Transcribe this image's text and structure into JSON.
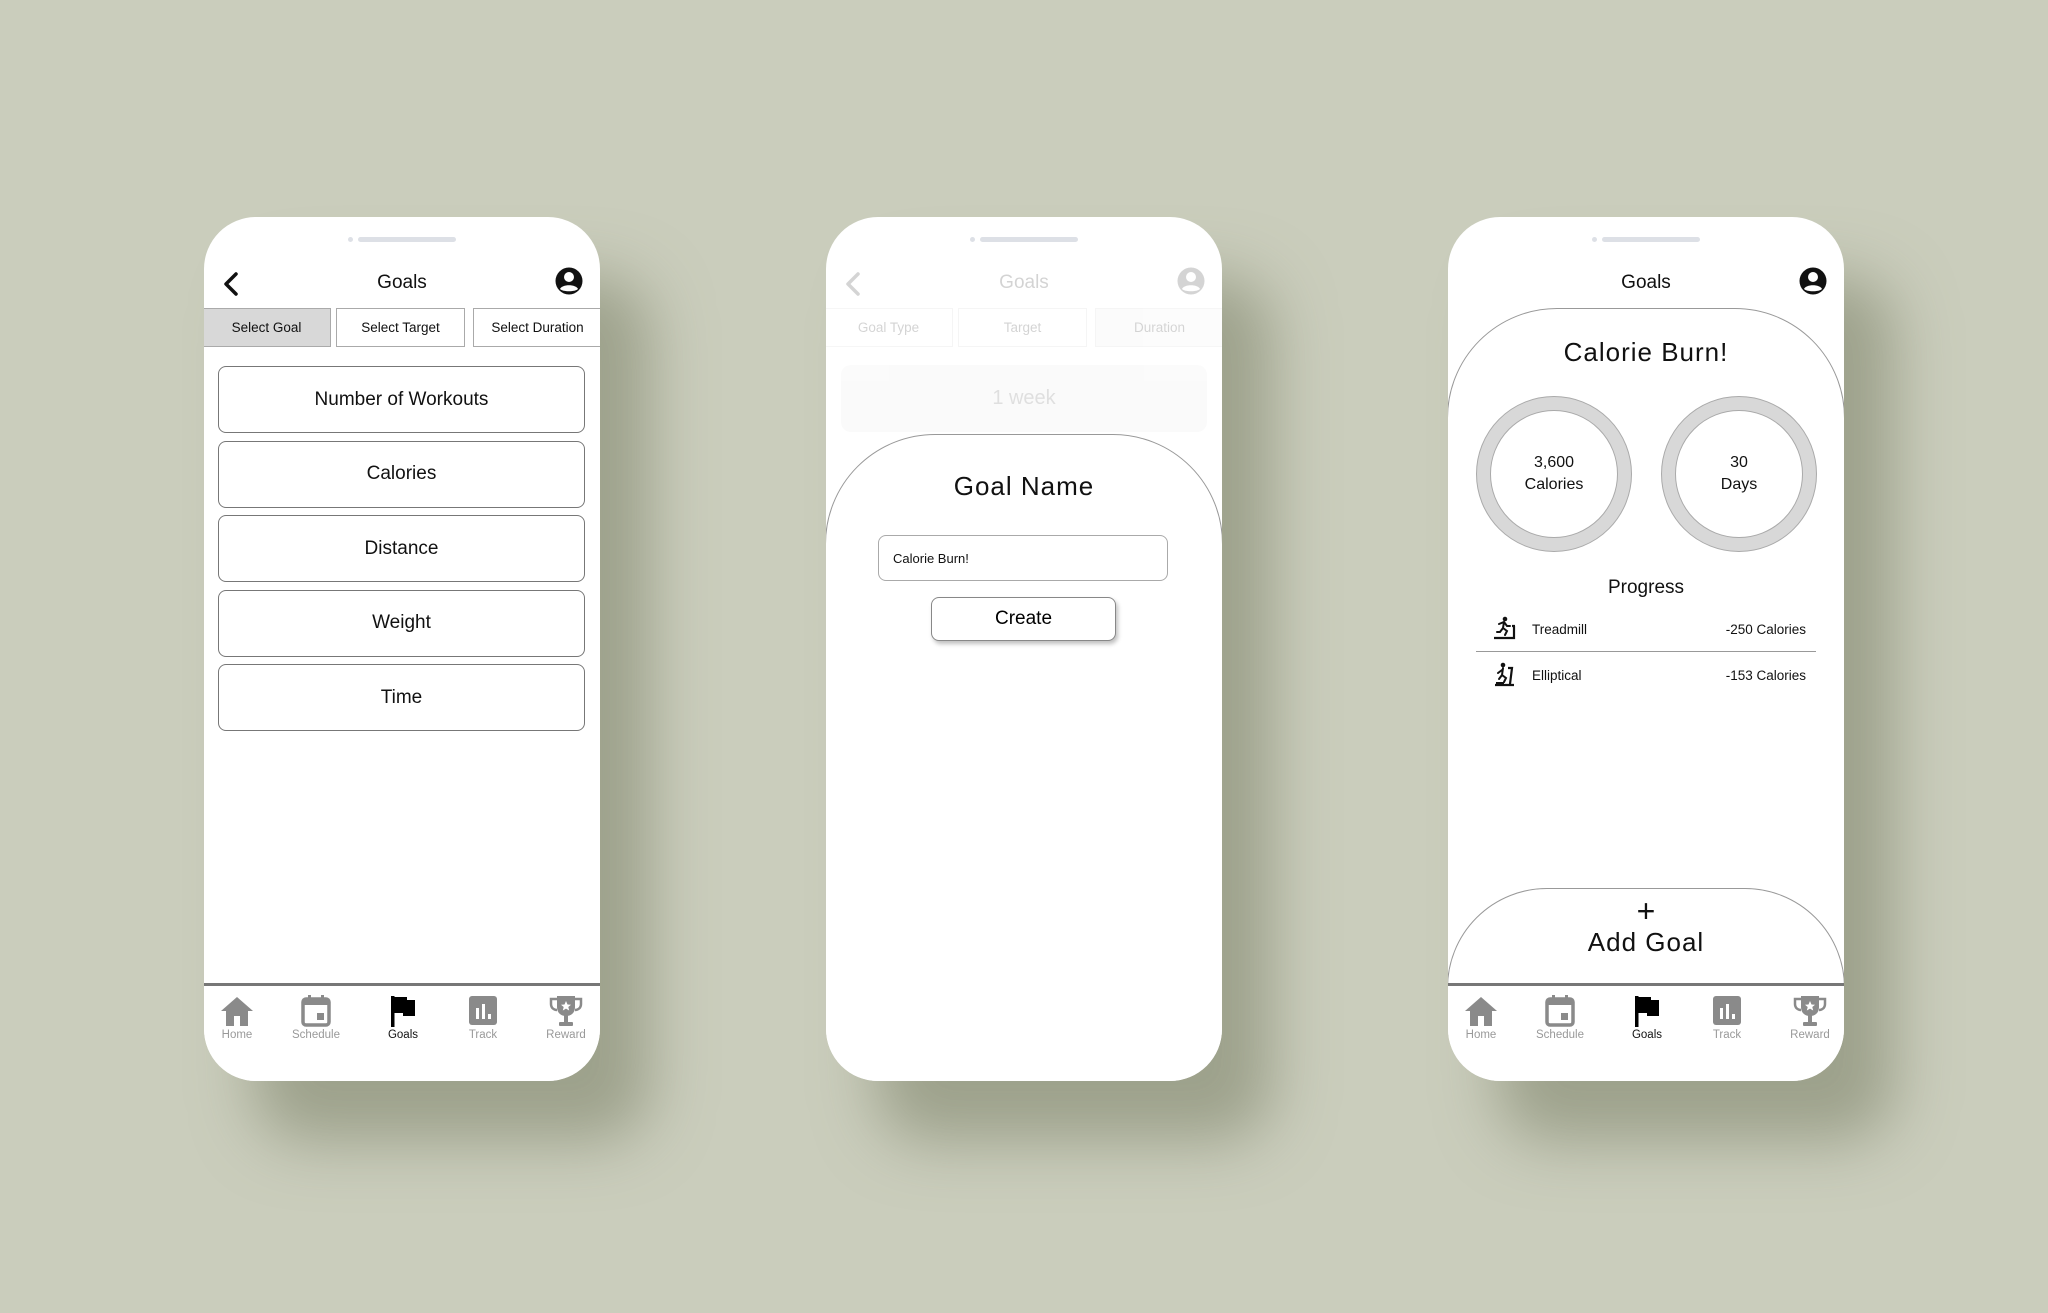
{
  "colors": {
    "background": "#cacdbc",
    "active_icon": "#000000",
    "inactive_icon": "#8a8a8a",
    "selected_tab": "#d8d8d8"
  },
  "nav": [
    {
      "label": "Home",
      "icon": "home-icon"
    },
    {
      "label": "Schedule",
      "icon": "calendar-icon"
    },
    {
      "label": "Goals",
      "icon": "flag-icon"
    },
    {
      "label": "Track",
      "icon": "bar-chart-icon"
    },
    {
      "label": "Reward",
      "icon": "trophy-icon"
    }
  ],
  "screen1": {
    "title": "Goals",
    "tabs": [
      {
        "label": "Select Goal",
        "active": true
      },
      {
        "label": "Select Target",
        "active": false
      },
      {
        "label": "Select Duration",
        "active": false
      }
    ],
    "options": [
      "Number of Workouts",
      "Calories",
      "Distance",
      "Weight",
      "Time"
    ],
    "active_nav": "Goals"
  },
  "screen2": {
    "title": "Goals",
    "tabs": [
      {
        "label": "Goal Type"
      },
      {
        "label": "Target"
      },
      {
        "label": "Duration"
      }
    ],
    "duration_value": "1 week",
    "sheet": {
      "title": "Goal Name",
      "input_value": "Calorie Burn!",
      "create_label": "Create"
    }
  },
  "screen3": {
    "title": "Goals",
    "goal_name": "Calorie Burn!",
    "rings": [
      {
        "value": "3,600",
        "unit": "Calories"
      },
      {
        "value": "30",
        "unit": "Days"
      }
    ],
    "progress_title": "Progress",
    "progress": [
      {
        "icon": "treadmill-icon",
        "name": "Treadmill",
        "value": "-250 Calories"
      },
      {
        "icon": "elliptical-icon",
        "name": "Elliptical",
        "value": "-153 Calories"
      }
    ],
    "add_goal": {
      "plus": "+",
      "label": "Add Goal"
    },
    "active_nav": "Goals"
  }
}
